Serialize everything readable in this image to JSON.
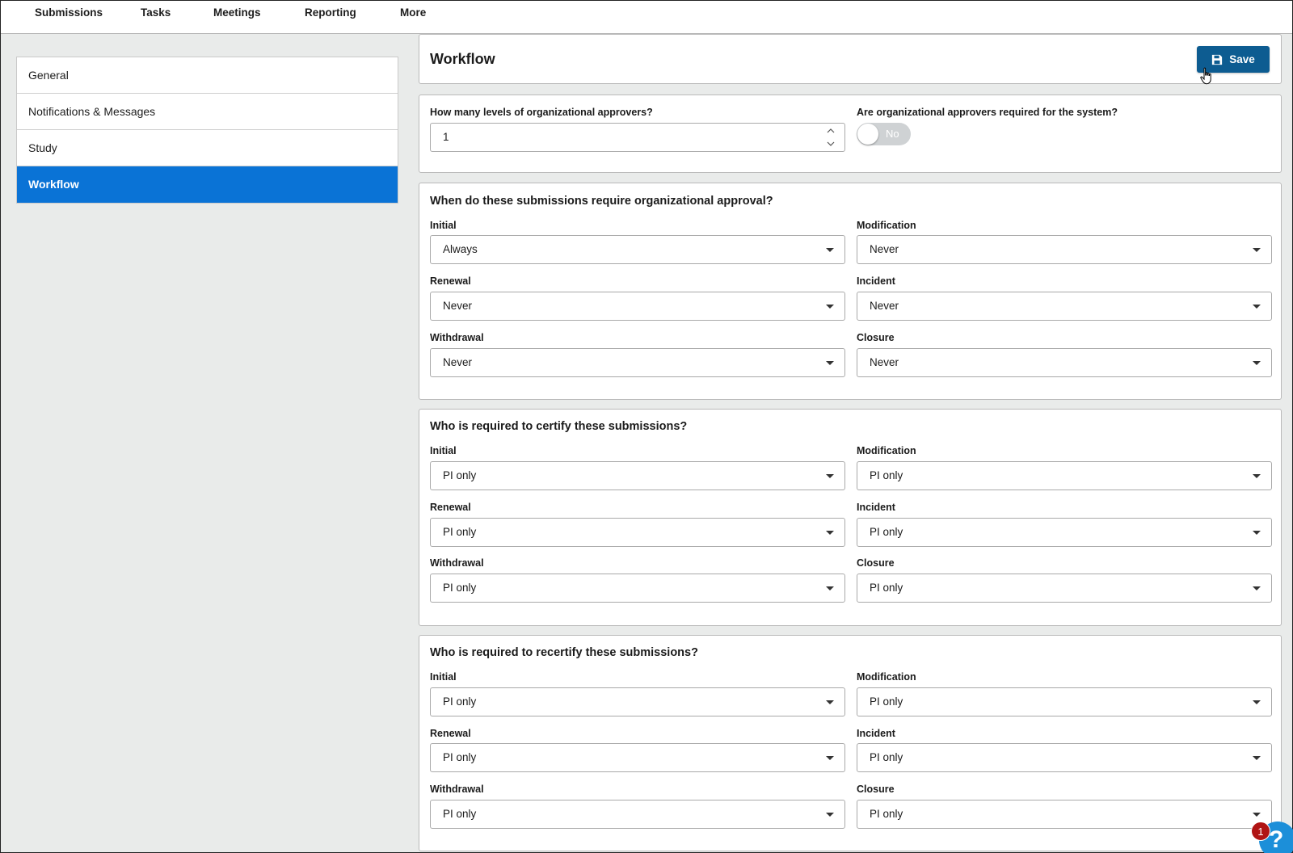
{
  "nav": {
    "items": [
      "Submissions",
      "Tasks",
      "Meetings",
      "Reporting",
      "More"
    ]
  },
  "sidebar": {
    "items": [
      {
        "label": "General"
      },
      {
        "label": "Notifications & Messages"
      },
      {
        "label": "Study"
      },
      {
        "label": "Workflow",
        "active": true
      }
    ]
  },
  "header": {
    "title": "Workflow",
    "save_label": "Save",
    "save_icon": "floppy-disk-icon"
  },
  "approvers": {
    "levels_label": "How many levels of organizational approvers?",
    "levels_value": "1",
    "required_label": "Are organizational approvers required for the system?",
    "required_toggle_label": "No",
    "required_on": false
  },
  "sections": [
    {
      "title": "When do these submissions require organizational approval?",
      "fields": [
        {
          "label": "Initial",
          "value": "Always"
        },
        {
          "label": "Modification",
          "value": "Never"
        },
        {
          "label": "Renewal",
          "value": "Never"
        },
        {
          "label": "Incident",
          "value": "Never"
        },
        {
          "label": "Withdrawal",
          "value": "Never"
        },
        {
          "label": "Closure",
          "value": "Never"
        }
      ]
    },
    {
      "title": "Who is required to certify these submissions?",
      "fields": [
        {
          "label": "Initial",
          "value": "PI only"
        },
        {
          "label": "Modification",
          "value": "PI only"
        },
        {
          "label": "Renewal",
          "value": "PI only"
        },
        {
          "label": "Incident",
          "value": "PI only"
        },
        {
          "label": "Withdrawal",
          "value": "PI only"
        },
        {
          "label": "Closure",
          "value": "PI only"
        }
      ]
    },
    {
      "title": "Who is required to recertify these submissions?",
      "fields": [
        {
          "label": "Initial",
          "value": "PI only"
        },
        {
          "label": "Modification",
          "value": "PI only"
        },
        {
          "label": "Renewal",
          "value": "PI only"
        },
        {
          "label": "Incident",
          "value": "PI only"
        },
        {
          "label": "Withdrawal",
          "value": "PI only"
        },
        {
          "label": "Closure",
          "value": "PI only"
        }
      ]
    }
  ],
  "help": {
    "glyph": "?",
    "badge_count": "1"
  },
  "colors": {
    "active_sidebar": "#0a73d6",
    "save_button": "#0d5c91",
    "badge": "#b01414"
  }
}
